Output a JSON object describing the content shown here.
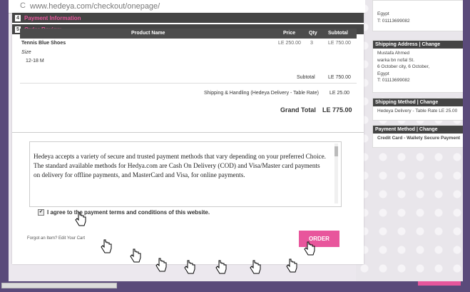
{
  "browser": {
    "url": "www.hedeya.com/checkout/onepage/"
  },
  "sections": {
    "payment": {
      "num": "4",
      "title": "Payment Information"
    },
    "review": {
      "num": "5",
      "title": "Order Review"
    }
  },
  "table": {
    "headers": {
      "name": "Product Name",
      "price": "Price",
      "qty": "Qty",
      "subtotal": "Subtotal"
    },
    "item": {
      "name": "Tennis Blue Shoes",
      "price": "LE 250.00",
      "qty": "3",
      "subtotal": "LE 750.00",
      "option_label": "Size",
      "option_value": "12-18 M"
    },
    "totals": {
      "subtotal_label": "Subtotal",
      "subtotal_value": "LE 750.00",
      "shipping_label": "Shipping & Handling (Hedeya Delivery - Table Rate)",
      "shipping_value": "LE 25.00",
      "grand_label": "Grand Total",
      "grand_value": "LE 775.00"
    }
  },
  "terms": {
    "text": "Hedeya accepts a variety of secure and trusted payment methods that vary depending on your preferred Choice. The standard available methods for Hedya.com are Cash On Delivery (COD) and Visa/Master card payments on delivery for offline payments, and MasterCard and Visa, for online payments.",
    "agree_label": "I agree to the payment terms and conditions of this website."
  },
  "footer": {
    "forgot": "Forgot an Item? Edit Your Cart",
    "order_button": "ORDER"
  },
  "sidebar": {
    "billing_lines": [
      "Egypt",
      "T: 01113699082"
    ],
    "shipping_address": {
      "title": "Shipping Address",
      "sep": "|",
      "change": "Change",
      "lines": [
        "Mustafa Ahmed",
        "warka bn nofal St.",
        "6 October city, 6 October,",
        "Egypt",
        "T: 01113699082"
      ]
    },
    "shipping_method": {
      "title": "Shipping Method",
      "sep": "|",
      "change": "Change",
      "value": "Hedeya Delivery - Table Rate LE 25.00"
    },
    "payment_method": {
      "title": "Payment Method",
      "sep": "|",
      "change": "Change",
      "value": "Credit Card - Wallety Secure Payment"
    }
  },
  "colors": {
    "accent": "#e8569c",
    "header_bg": "#444444",
    "outer_bg": "#5a4a7a"
  }
}
